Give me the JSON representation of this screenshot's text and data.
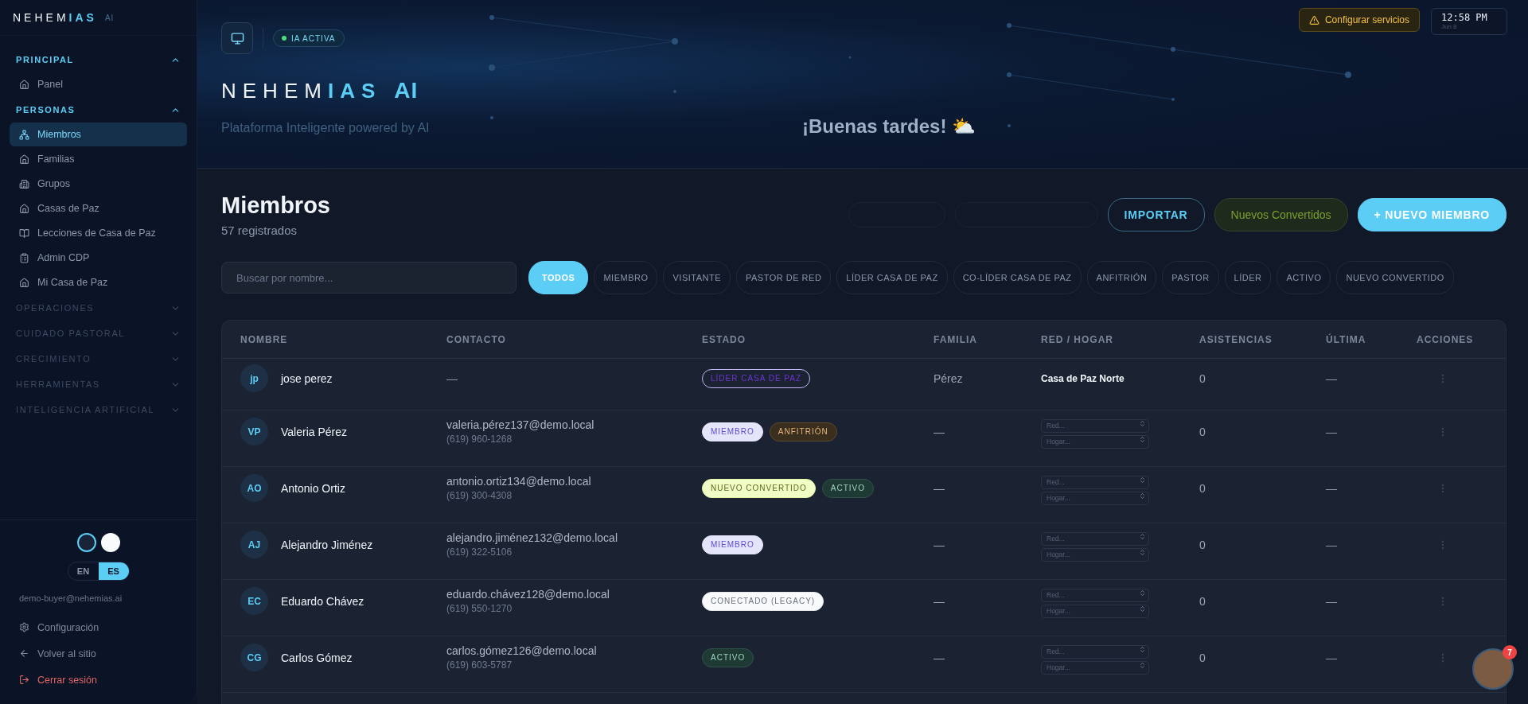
{
  "sidebar": {
    "logo": {
      "prefix": "NEHEM",
      "highlight": "IAS",
      "suffix": "AI"
    },
    "sections": [
      {
        "title": "PRINCIPAL",
        "expanded": true,
        "items": [
          {
            "label": "Panel",
            "selected": false
          }
        ]
      },
      {
        "title": "PERSONAS",
        "expanded": true,
        "items": [
          {
            "label": "Miembros",
            "selected": true
          },
          {
            "label": "Familias",
            "selected": false
          },
          {
            "label": "Grupos",
            "selected": false
          },
          {
            "label": "Casas de Paz",
            "selected": false
          },
          {
            "label": "Lecciones de Casa de Paz",
            "selected": false
          },
          {
            "label": "Admin CDP",
            "selected": false
          },
          {
            "label": "Mi Casa de Paz",
            "selected": false
          }
        ]
      },
      {
        "title": "OPERACIONES",
        "expanded": false
      },
      {
        "title": "CUIDADO PASTORAL",
        "expanded": false
      },
      {
        "title": "CRECIMIENTO",
        "expanded": false
      },
      {
        "title": "HERRAMIENTAS",
        "expanded": false
      },
      {
        "title": "INTELIGENCIA ARTIFICIAL",
        "expanded": false
      }
    ],
    "themes": [
      {
        "selected": true
      },
      {
        "selected": false
      }
    ],
    "languages": [
      {
        "label": "EN",
        "selected": false
      },
      {
        "label": "ES",
        "selected": true
      }
    ],
    "email": "demo-buyer@nehemias.ai",
    "footer_links": [
      {
        "label": "Configuración",
        "kind": "settings"
      },
      {
        "label": "Volver al sitio",
        "kind": "back"
      },
      {
        "label": "Cerrar sesión",
        "kind": "logout"
      }
    ]
  },
  "header": {
    "status": "IA ACTIVA",
    "logo": {
      "prefix": "NEHEM",
      "highlight": "IAS",
      "suffix": "AI"
    },
    "subtitle": "Plataforma Inteligente powered by AI",
    "greeting": "¡Buenas tardes! ⛅",
    "config_button": "Configurar servicios",
    "clock": {
      "time": "12:58 PM",
      "date": "Jun 8"
    }
  },
  "page": {
    "title": "Miembros",
    "count": "57 registrados",
    "actions": [
      {
        "label": "IMPORTAR",
        "kind": "outline"
      },
      {
        "label": "Nuevos Convertidos",
        "kind": "green"
      },
      {
        "label": "+ NUEVO MIEMBRO",
        "kind": "primary"
      }
    ],
    "search": {
      "placeholder": "Buscar por nombre..."
    },
    "filters": [
      {
        "label": "TODOS",
        "selected": true
      },
      {
        "label": "MIEMBRO",
        "selected": false
      },
      {
        "label": "VISITANTE",
        "selected": false
      },
      {
        "label": "PASTOR DE RED",
        "selected": false
      },
      {
        "label": "LÍDER CASA DE PAZ",
        "selected": false
      },
      {
        "label": "CO-LÍDER CASA DE PAZ",
        "selected": false
      },
      {
        "label": "ANFITRIÓN",
        "selected": false
      },
      {
        "label": "PASTOR",
        "selected": false
      },
      {
        "label": "LÍDER",
        "selected": false
      },
      {
        "label": "ACTIVO",
        "selected": false
      },
      {
        "label": "NUEVO CONVERTIDO",
        "selected": false
      }
    ]
  },
  "table": {
    "columns": [
      "NOMBRE",
      "CONTACTO",
      "ESTADO",
      "FAMILIA",
      "RED / HOGAR",
      "ASISTENCIAS",
      "ÚLTIMA",
      "ACCIONES"
    ],
    "rows": [
      {
        "initials": "jp",
        "name": "jose perez",
        "email": "—",
        "phone": "",
        "tags": [
          {
            "label": "LÍDER CASA DE PAZ",
            "kind": "leader"
          }
        ],
        "family": "Pérez",
        "network": "Casa de Paz Norte",
        "attendance": "0",
        "last": "—"
      },
      {
        "initials": "VP",
        "name": "Valeria Pérez",
        "email": "valeria.pérez137@demo.local",
        "phone": "(619) 960-1268",
        "tags": [
          {
            "label": "MIEMBRO",
            "kind": "member"
          },
          {
            "label": "ANFITRIÓN",
            "kind": "host"
          }
        ],
        "family": "—",
        "selects": [
          {
            "placeholder": "Red..."
          },
          {
            "placeholder": "Hogar..."
          }
        ],
        "attendance": "0",
        "last": "—"
      },
      {
        "initials": "AO",
        "name": "Antonio Ortiz",
        "email": "antonio.ortiz134@demo.local",
        "phone": "(619) 300-4308",
        "tags": [
          {
            "label": "NUEVO CONVERTIDO",
            "kind": "convert"
          },
          {
            "label": "ACTIVO",
            "kind": "active"
          }
        ],
        "family": "—",
        "selects": [
          {
            "placeholder": "Red..."
          },
          {
            "placeholder": "Hogar..."
          }
        ],
        "attendance": "0",
        "last": "—"
      },
      {
        "initials": "AJ",
        "name": "Alejandro Jiménez",
        "email": "alejandro.jiménez132@demo.local",
        "phone": "(619) 322-5106",
        "tags": [
          {
            "label": "MIEMBRO",
            "kind": "member"
          }
        ],
        "family": "—",
        "selects": [
          {
            "placeholder": "Red..."
          },
          {
            "placeholder": "Hogar..."
          }
        ],
        "attendance": "0",
        "last": "—"
      },
      {
        "initials": "EC",
        "name": "Eduardo Chávez",
        "email": "eduardo.chávez128@demo.local",
        "phone": "(619) 550-1270",
        "tags": [
          {
            "label": "CONECTADO (LEGACY)",
            "kind": "legacy"
          }
        ],
        "family": "—",
        "selects": [
          {
            "placeholder": "Red..."
          },
          {
            "placeholder": "Hogar..."
          }
        ],
        "attendance": "0",
        "last": "—"
      },
      {
        "initials": "CG",
        "name": "Carlos Gómez",
        "email": "carlos.gómez126@demo.local",
        "phone": "(619) 603-5787",
        "tags": [
          {
            "label": "ACTIVO",
            "kind": "active"
          }
        ],
        "family": "—",
        "selects": [
          {
            "placeholder": "Red..."
          },
          {
            "placeholder": "Hogar..."
          }
        ],
        "attendance": "0",
        "last": "—"
      }
    ]
  },
  "chat": {
    "badge": "7"
  }
}
